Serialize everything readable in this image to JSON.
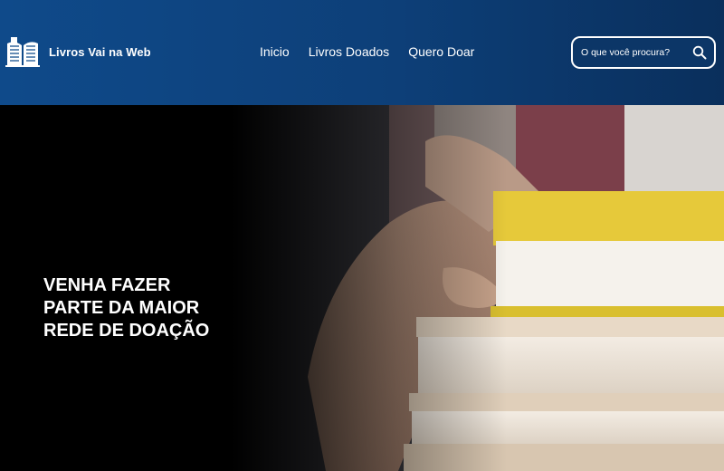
{
  "header": {
    "brand": {
      "name": "Livros Vai na Web",
      "icon": "open-book-icon"
    },
    "nav": [
      {
        "label": "Inicio"
      },
      {
        "label": "Livros Doados"
      },
      {
        "label": "Quero Doar"
      }
    ],
    "search": {
      "placeholder": "O que você procura?",
      "icon": "search-icon"
    },
    "colors": {
      "background": "#0d3f78",
      "text": "#ffffff"
    }
  },
  "hero": {
    "headline_lines": [
      "VENHA FAZER",
      "PARTE DA MAIOR",
      "REDE DE DOAÇÃO"
    ],
    "colors": {
      "background": "#000000",
      "book_cover": "#e6c93a"
    }
  }
}
